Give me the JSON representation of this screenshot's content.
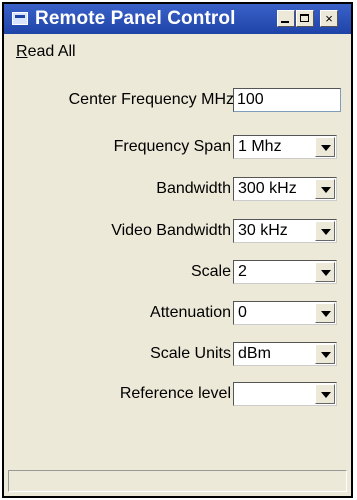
{
  "window": {
    "title": "Remote Panel Control",
    "close_glyph": "×"
  },
  "menu": {
    "read_all": "Read All"
  },
  "fields": {
    "center_frequency": {
      "label": "Center Frequency MHz",
      "value": "100"
    },
    "frequency_span": {
      "label": "Frequency Span",
      "value": "1 Mhz"
    },
    "bandwidth": {
      "label": "Bandwidth",
      "value": "300 kHz"
    },
    "video_bandwidth": {
      "label": "Video Bandwidth",
      "value": "30 kHz"
    },
    "scale": {
      "label": "Scale",
      "value": "2"
    },
    "attenuation": {
      "label": "Attenuation",
      "value": "0"
    },
    "scale_units": {
      "label": "Scale Units",
      "value": "dBm"
    },
    "reference_level": {
      "label": "Reference level",
      "value": ""
    }
  }
}
